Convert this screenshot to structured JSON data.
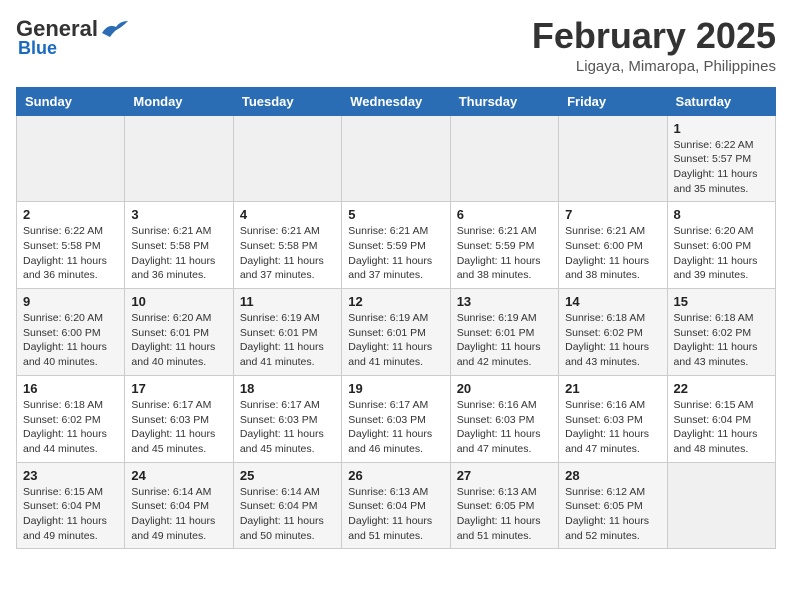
{
  "header": {
    "logo_general": "General",
    "logo_blue": "Blue",
    "month_title": "February 2025",
    "location": "Ligaya, Mimaropa, Philippines"
  },
  "days_of_week": [
    "Sunday",
    "Monday",
    "Tuesday",
    "Wednesday",
    "Thursday",
    "Friday",
    "Saturday"
  ],
  "weeks": [
    [
      {
        "day": "",
        "info": ""
      },
      {
        "day": "",
        "info": ""
      },
      {
        "day": "",
        "info": ""
      },
      {
        "day": "",
        "info": ""
      },
      {
        "day": "",
        "info": ""
      },
      {
        "day": "",
        "info": ""
      },
      {
        "day": "1",
        "info": "Sunrise: 6:22 AM\nSunset: 5:57 PM\nDaylight: 11 hours and 35 minutes."
      }
    ],
    [
      {
        "day": "2",
        "info": "Sunrise: 6:22 AM\nSunset: 5:58 PM\nDaylight: 11 hours and 36 minutes."
      },
      {
        "day": "3",
        "info": "Sunrise: 6:21 AM\nSunset: 5:58 PM\nDaylight: 11 hours and 36 minutes."
      },
      {
        "day": "4",
        "info": "Sunrise: 6:21 AM\nSunset: 5:58 PM\nDaylight: 11 hours and 37 minutes."
      },
      {
        "day": "5",
        "info": "Sunrise: 6:21 AM\nSunset: 5:59 PM\nDaylight: 11 hours and 37 minutes."
      },
      {
        "day": "6",
        "info": "Sunrise: 6:21 AM\nSunset: 5:59 PM\nDaylight: 11 hours and 38 minutes."
      },
      {
        "day": "7",
        "info": "Sunrise: 6:21 AM\nSunset: 6:00 PM\nDaylight: 11 hours and 38 minutes."
      },
      {
        "day": "8",
        "info": "Sunrise: 6:20 AM\nSunset: 6:00 PM\nDaylight: 11 hours and 39 minutes."
      }
    ],
    [
      {
        "day": "9",
        "info": "Sunrise: 6:20 AM\nSunset: 6:00 PM\nDaylight: 11 hours and 40 minutes."
      },
      {
        "day": "10",
        "info": "Sunrise: 6:20 AM\nSunset: 6:01 PM\nDaylight: 11 hours and 40 minutes."
      },
      {
        "day": "11",
        "info": "Sunrise: 6:19 AM\nSunset: 6:01 PM\nDaylight: 11 hours and 41 minutes."
      },
      {
        "day": "12",
        "info": "Sunrise: 6:19 AM\nSunset: 6:01 PM\nDaylight: 11 hours and 41 minutes."
      },
      {
        "day": "13",
        "info": "Sunrise: 6:19 AM\nSunset: 6:01 PM\nDaylight: 11 hours and 42 minutes."
      },
      {
        "day": "14",
        "info": "Sunrise: 6:18 AM\nSunset: 6:02 PM\nDaylight: 11 hours and 43 minutes."
      },
      {
        "day": "15",
        "info": "Sunrise: 6:18 AM\nSunset: 6:02 PM\nDaylight: 11 hours and 43 minutes."
      }
    ],
    [
      {
        "day": "16",
        "info": "Sunrise: 6:18 AM\nSunset: 6:02 PM\nDaylight: 11 hours and 44 minutes."
      },
      {
        "day": "17",
        "info": "Sunrise: 6:17 AM\nSunset: 6:03 PM\nDaylight: 11 hours and 45 minutes."
      },
      {
        "day": "18",
        "info": "Sunrise: 6:17 AM\nSunset: 6:03 PM\nDaylight: 11 hours and 45 minutes."
      },
      {
        "day": "19",
        "info": "Sunrise: 6:17 AM\nSunset: 6:03 PM\nDaylight: 11 hours and 46 minutes."
      },
      {
        "day": "20",
        "info": "Sunrise: 6:16 AM\nSunset: 6:03 PM\nDaylight: 11 hours and 47 minutes."
      },
      {
        "day": "21",
        "info": "Sunrise: 6:16 AM\nSunset: 6:03 PM\nDaylight: 11 hours and 47 minutes."
      },
      {
        "day": "22",
        "info": "Sunrise: 6:15 AM\nSunset: 6:04 PM\nDaylight: 11 hours and 48 minutes."
      }
    ],
    [
      {
        "day": "23",
        "info": "Sunrise: 6:15 AM\nSunset: 6:04 PM\nDaylight: 11 hours and 49 minutes."
      },
      {
        "day": "24",
        "info": "Sunrise: 6:14 AM\nSunset: 6:04 PM\nDaylight: 11 hours and 49 minutes."
      },
      {
        "day": "25",
        "info": "Sunrise: 6:14 AM\nSunset: 6:04 PM\nDaylight: 11 hours and 50 minutes."
      },
      {
        "day": "26",
        "info": "Sunrise: 6:13 AM\nSunset: 6:04 PM\nDaylight: 11 hours and 51 minutes."
      },
      {
        "day": "27",
        "info": "Sunrise: 6:13 AM\nSunset: 6:05 PM\nDaylight: 11 hours and 51 minutes."
      },
      {
        "day": "28",
        "info": "Sunrise: 6:12 AM\nSunset: 6:05 PM\nDaylight: 11 hours and 52 minutes."
      },
      {
        "day": "",
        "info": ""
      }
    ]
  ]
}
